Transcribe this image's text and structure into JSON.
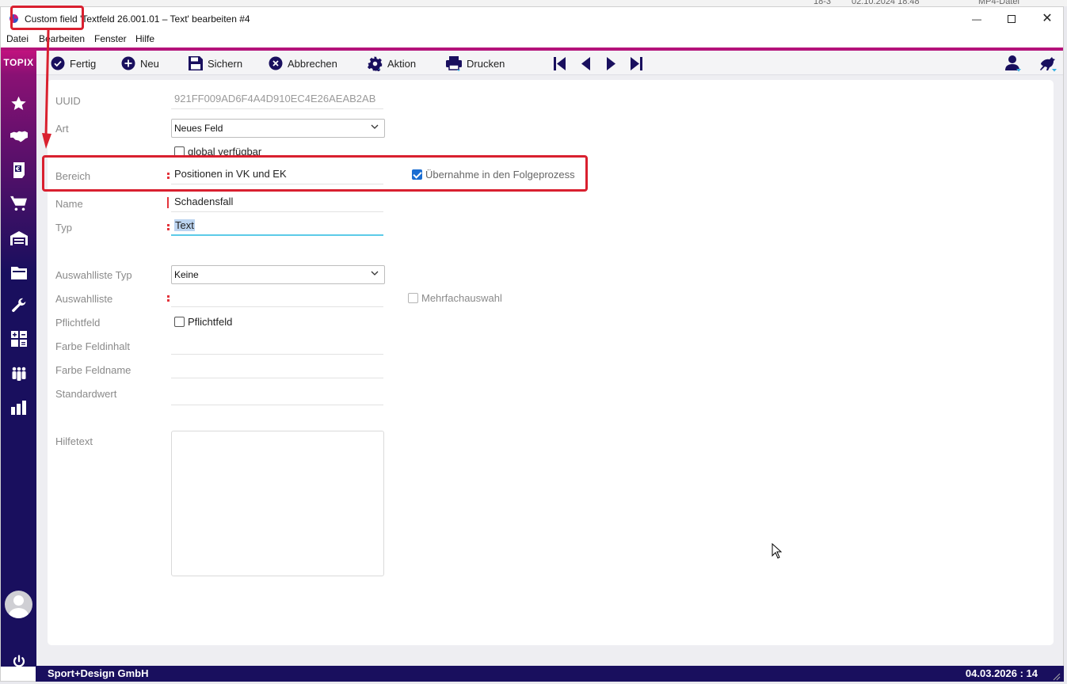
{
  "background": {
    "item1": "18-3",
    "item2": "02.10.2024 18:48",
    "item3": "MP4-Datei"
  },
  "window": {
    "title_prefix": "Custom field",
    "title_rest": "'Textfeld 26.001.01 – Text' bearbeiten #4",
    "minimize": "—",
    "close": "✕"
  },
  "menu": [
    "Datei",
    "Bearbeiten",
    "Fenster",
    "Hilfe"
  ],
  "brand": "TOPIX",
  "toolbar": {
    "fertig": "Fertig",
    "neu": "Neu",
    "sichern": "Sichern",
    "abbrechen": "Abbrechen",
    "aktion": "Aktion",
    "drucken": "Drucken"
  },
  "form": {
    "uuid_label": "UUID",
    "uuid_value": "921FF009AD6F4A4D910EC4E26AEAB2AB",
    "art_label": "Art",
    "art_value": "Neues Feld",
    "global_label": "global verfügbar",
    "global_checked": false,
    "bereich_label": "Bereich",
    "bereich_value": "Positionen in VK und EK",
    "uebernahme_label": "Übernahme in den Folgeprozess",
    "uebernahme_checked": true,
    "name_label": "Name",
    "name_value": "Schadensfall",
    "typ_label": "Typ",
    "typ_value": "Text",
    "auswahlliste_typ_label": "Auswahlliste Typ",
    "auswahlliste_typ_value": "Keine",
    "auswahlliste_label": "Auswahlliste",
    "auswahlliste_value": "",
    "mehrfach_label": "Mehrfachauswahl",
    "pflichtfeld_label": "Pflichtfeld",
    "pflichtfeld_check_label": "Pflichtfeld",
    "farbe_inhalt_label": "Farbe Feldinhalt",
    "farbe_name_label": "Farbe Feldname",
    "standardwert_label": "Standardwert",
    "hilfetext_label": "Hilfetext"
  },
  "status": {
    "company": "Sport+Design GmbH",
    "datetime": "04.03.2026 : 14"
  },
  "colors": {
    "sidebar": "#190f5e",
    "accent": "#b4137a",
    "annotation": "#d9202f",
    "checkbox_checked": "#1a6dd2"
  }
}
